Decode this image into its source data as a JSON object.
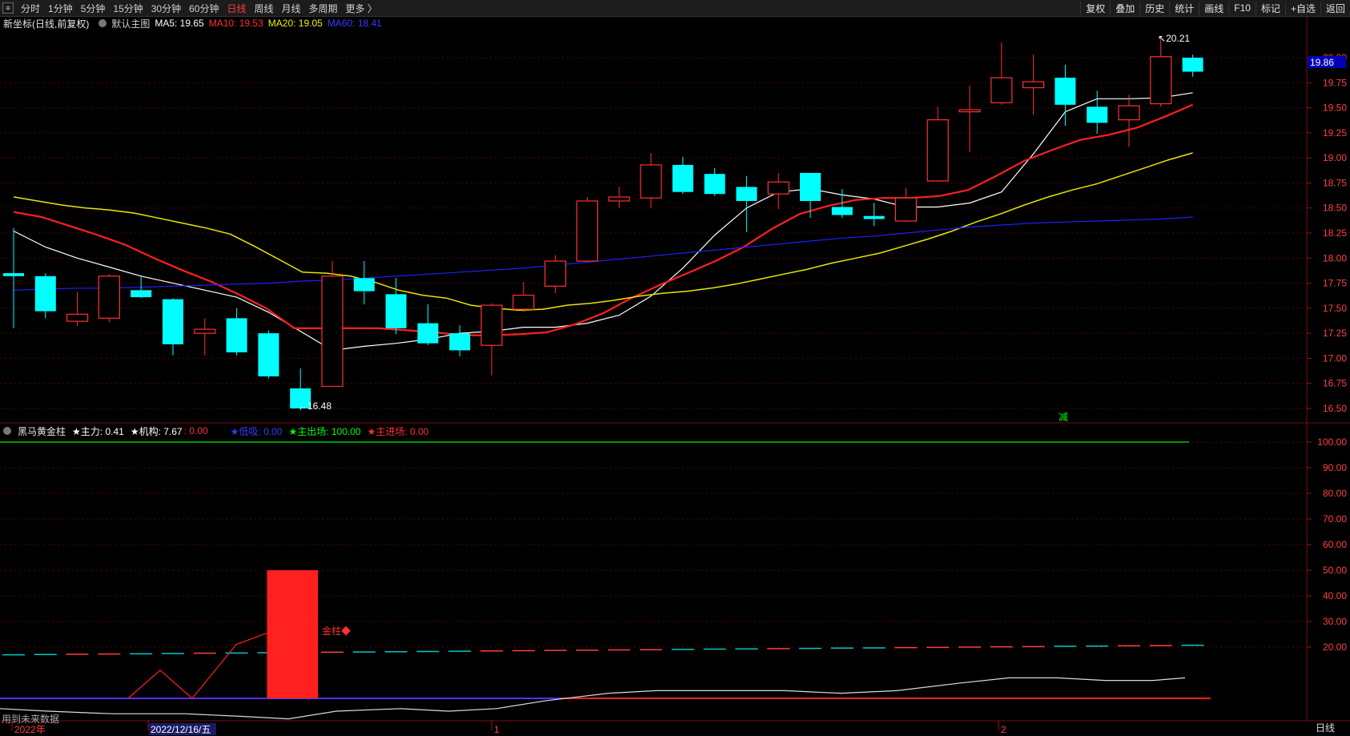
{
  "toolbar": {
    "periods": [
      "分时",
      "1分钟",
      "5分钟",
      "15分钟",
      "30分钟",
      "60分钟",
      "日线",
      "周线",
      "月线",
      "多周期",
      "更多 〉"
    ],
    "active_period": "日线",
    "right_buttons": [
      "复权",
      "叠加",
      "历史",
      "统计",
      "画线",
      "F10",
      "标记",
      "+自选",
      "返回"
    ]
  },
  "main_info": {
    "name": "新坐标(日线,前复权)",
    "template": "默认主图",
    "ma5": "MA5: 19.65",
    "ma10": "MA10: 19.53",
    "ma20": "MA20: 19.05",
    "ma60": "MA60: 18.41"
  },
  "indicator_info": {
    "name": "黑马黄金柱",
    "main_force": "★主力: 0.41",
    "institution": "★机构: 7.67",
    "sep": ": 0.00",
    "low_suck": "★低吸: 0.00",
    "main_exit": "★主出场: 100.00",
    "main_enter": "★主进场: 0.00"
  },
  "annotations": {
    "high": "20.21",
    "low": "16.48",
    "current_price": "19.86",
    "jian": "减",
    "golden": "金柱◆",
    "future_note": "用到未来数据"
  },
  "axis": {
    "price_ticks": [
      "20.00",
      "19.75",
      "19.50",
      "19.25",
      "19.00",
      "18.75",
      "18.50",
      "18.25",
      "18.00",
      "17.75",
      "17.50",
      "17.25",
      "17.00",
      "16.75",
      "16.50"
    ],
    "ind_ticks": [
      "100.00",
      "90.00",
      "80.00",
      "70.00",
      "60.00",
      "50.00",
      "40.00",
      "30.00",
      "20.00"
    ],
    "date_labels": [
      "2022年",
      "2022/12/16/五",
      "1",
      "2"
    ],
    "period_tab": "日线"
  },
  "colors": {
    "up": "#ff3232",
    "down": "#00ffff",
    "ma5": "#ffffff",
    "ma10": "#ff2020",
    "ma20": "#e8e800",
    "ma60": "#2020ff"
  },
  "chart_data": [
    {
      "type": "candlestick",
      "title": "新坐标(日线,前复权)",
      "ylim": [
        16.35,
        20.25
      ],
      "candles": [
        {
          "o": 17.85,
          "h": 18.3,
          "l": 17.3,
          "c": 17.82
        },
        {
          "o": 17.82,
          "h": 17.85,
          "l": 17.4,
          "c": 17.47
        },
        {
          "o": 17.37,
          "h": 17.66,
          "l": 17.32,
          "c": 17.44
        },
        {
          "o": 17.4,
          "h": 17.84,
          "l": 17.36,
          "c": 17.82
        },
        {
          "o": 17.68,
          "h": 17.82,
          "l": 17.6,
          "c": 17.61
        },
        {
          "o": 17.59,
          "h": 17.6,
          "l": 17.03,
          "c": 17.14
        },
        {
          "o": 17.25,
          "h": 17.4,
          "l": 17.03,
          "c": 17.29
        },
        {
          "o": 17.4,
          "h": 17.5,
          "l": 17.03,
          "c": 17.06
        },
        {
          "o": 17.25,
          "h": 17.28,
          "l": 16.8,
          "c": 16.82
        },
        {
          "o": 16.7,
          "h": 16.9,
          "l": 16.48,
          "c": 16.5
        },
        {
          "o": 16.72,
          "h": 17.97,
          "l": 16.72,
          "c": 17.82
        },
        {
          "o": 17.8,
          "h": 17.97,
          "l": 17.54,
          "c": 17.67
        },
        {
          "o": 17.64,
          "h": 17.8,
          "l": 17.24,
          "c": 17.3
        },
        {
          "o": 17.35,
          "h": 17.54,
          "l": 17.13,
          "c": 17.15
        },
        {
          "o": 17.25,
          "h": 17.33,
          "l": 17.02,
          "c": 17.08
        },
        {
          "o": 17.13,
          "h": 17.55,
          "l": 16.83,
          "c": 17.53
        },
        {
          "o": 17.49,
          "h": 17.76,
          "l": 17.46,
          "c": 17.63
        },
        {
          "o": 17.72,
          "h": 18.03,
          "l": 17.65,
          "c": 17.97
        },
        {
          "o": 17.97,
          "h": 18.61,
          "l": 17.96,
          "c": 18.57
        },
        {
          "o": 18.57,
          "h": 18.71,
          "l": 18.5,
          "c": 18.61
        },
        {
          "o": 18.6,
          "h": 19.05,
          "l": 18.5,
          "c": 18.93
        },
        {
          "o": 18.93,
          "h": 19.01,
          "l": 18.64,
          "c": 18.66
        },
        {
          "o": 18.84,
          "h": 18.9,
          "l": 18.62,
          "c": 18.64
        },
        {
          "o": 18.71,
          "h": 18.82,
          "l": 18.26,
          "c": 18.57
        },
        {
          "o": 18.64,
          "h": 18.85,
          "l": 18.49,
          "c": 18.76
        },
        {
          "o": 18.85,
          "h": 18.85,
          "l": 18.4,
          "c": 18.57
        },
        {
          "o": 18.51,
          "h": 18.69,
          "l": 18.4,
          "c": 18.43
        },
        {
          "o": 18.42,
          "h": 18.55,
          "l": 18.32,
          "c": 18.39
        },
        {
          "o": 18.37,
          "h": 18.7,
          "l": 18.36,
          "c": 18.6
        },
        {
          "o": 18.77,
          "h": 19.51,
          "l": 18.77,
          "c": 19.38
        },
        {
          "o": 19.46,
          "h": 19.72,
          "l": 19.06,
          "c": 19.48
        },
        {
          "o": 19.55,
          "h": 20.15,
          "l": 19.53,
          "c": 19.8
        },
        {
          "o": 19.7,
          "h": 20.03,
          "l": 19.43,
          "c": 19.76
        },
        {
          "o": 19.8,
          "h": 19.93,
          "l": 19.32,
          "c": 19.53
        },
        {
          "o": 19.51,
          "h": 19.67,
          "l": 19.24,
          "c": 19.35
        },
        {
          "o": 19.38,
          "h": 19.63,
          "l": 19.11,
          "c": 19.52
        },
        {
          "o": 19.54,
          "h": 20.21,
          "l": 19.51,
          "c": 20.01
        },
        {
          "o": 20.0,
          "h": 20.03,
          "l": 19.81,
          "c": 19.86
        }
      ],
      "series": [
        {
          "name": "MA5",
          "values": [
            18.27,
            18.11,
            18.0,
            17.91,
            17.82,
            17.75,
            17.68,
            17.61,
            17.46,
            17.27,
            17.08,
            17.12,
            17.15,
            17.19,
            17.25,
            17.27,
            17.31,
            17.31,
            17.35,
            17.43,
            17.62,
            17.9,
            18.23,
            18.5,
            18.66,
            18.69,
            18.63,
            18.59,
            18.51,
            18.51,
            18.55,
            18.66,
            19.04,
            19.46,
            19.59,
            19.59,
            19.6,
            19.65
          ]
        },
        {
          "name": "MA10",
          "values": [
            18.46,
            18.41,
            18.32,
            18.23,
            18.13,
            18.0,
            17.88,
            17.77,
            17.64,
            17.5,
            17.3,
            17.3,
            17.3,
            17.3,
            17.28,
            17.26,
            17.23,
            17.23,
            17.24,
            17.26,
            17.34,
            17.45,
            17.6,
            17.73,
            17.85,
            17.97,
            18.11,
            18.29,
            18.44,
            18.52,
            18.58,
            18.6,
            18.6,
            18.62,
            18.68,
            18.82,
            18.97,
            19.08,
            19.18,
            19.23,
            19.3,
            19.41,
            19.53
          ]
        },
        {
          "name": "MA20",
          "values": [
            18.61,
            18.57,
            18.53,
            18.5,
            18.48,
            18.45,
            18.4,
            18.35,
            18.3,
            18.24,
            18.12,
            17.99,
            17.86,
            17.85,
            17.82,
            17.76,
            17.68,
            17.63,
            17.6,
            17.53,
            17.5,
            17.48,
            17.49,
            17.53,
            17.55,
            17.58,
            17.62,
            17.65,
            17.67,
            17.7,
            17.74,
            17.79,
            17.84,
            17.89,
            17.95,
            18.0,
            18.05,
            18.12,
            18.19,
            18.27,
            18.36,
            18.44,
            18.53,
            18.61,
            18.68,
            18.74,
            18.82,
            18.9,
            18.98,
            19.05
          ]
        },
        {
          "name": "MA60",
          "values": [
            17.68,
            17.69,
            17.7,
            17.7,
            17.71,
            17.72,
            17.73,
            17.74,
            17.75,
            17.77,
            17.78,
            17.8,
            17.82,
            17.84,
            17.86,
            17.88,
            17.9,
            17.93,
            17.96,
            17.99,
            18.02,
            18.05,
            18.08,
            18.11,
            18.14,
            18.17,
            18.2,
            18.22,
            18.25,
            18.28,
            18.31,
            18.33,
            18.35,
            18.36,
            18.37,
            18.38,
            18.39,
            18.41
          ]
        }
      ]
    },
    {
      "type": "bar",
      "title": "黑马黄金柱",
      "ylim": [
        0,
        105
      ],
      "series": [
        {
          "name": "主力",
          "values": [
            0.41
          ]
        },
        {
          "name": "机构",
          "values": [
            7.67
          ]
        },
        {
          "name": "低吸",
          "values": [
            0.0
          ]
        },
        {
          "name": "主出场",
          "values": [
            100.0
          ]
        },
        {
          "name": "主进场",
          "values": [
            0.0
          ]
        }
      ],
      "golden_bar": {
        "start_index": 8,
        "end_index": 9,
        "value": 50
      }
    }
  ]
}
